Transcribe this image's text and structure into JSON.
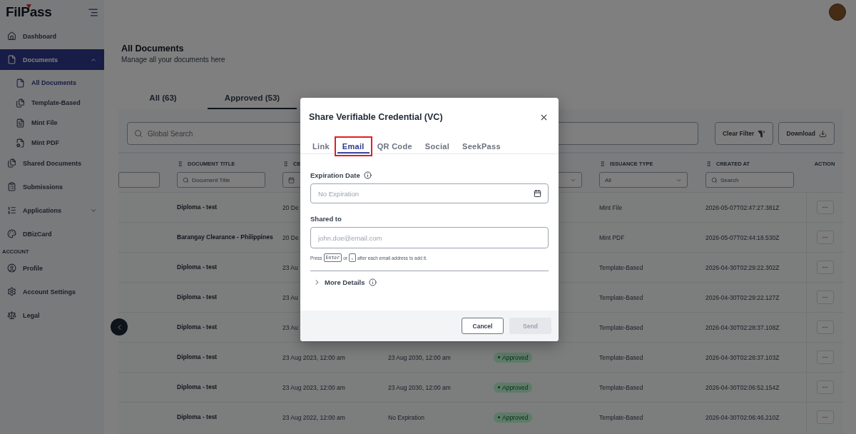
{
  "sidebar": {
    "logo": "FilPass",
    "groups": [
      {
        "items": [
          {
            "label": "Dashboard",
            "selected": false
          },
          {
            "label": "Documents",
            "selected": true,
            "expanded": true,
            "children": [
              {
                "label": "All Documents",
                "selected": true
              },
              {
                "label": "Template-Based",
                "selected": false
              },
              {
                "label": "Mint File",
                "selected": false
              },
              {
                "label": "Mint PDF",
                "selected": false
              }
            ]
          },
          {
            "label": "Shared Documents",
            "selected": false
          },
          {
            "label": "Submissions",
            "selected": false
          },
          {
            "label": "Applications",
            "selected": false,
            "expanded": false
          },
          {
            "label": "DBizCard",
            "selected": false
          }
        ]
      },
      {
        "label": "ACCOUNT",
        "items": [
          {
            "label": "Profile",
            "selected": false
          },
          {
            "label": "Account Settings",
            "selected": false
          },
          {
            "label": "Legal",
            "selected": false
          }
        ]
      }
    ]
  },
  "page": {
    "title": "All Documents",
    "subtitle": "Manage all your documents here"
  },
  "tabs": [
    {
      "label": "All (63)",
      "selected": false
    },
    {
      "label": "Approved (53)",
      "selected": true
    }
  ],
  "toolbar": {
    "search_placeholder": "Global Search",
    "buttons": [
      {
        "label": "Clear Filter",
        "kind": "clear"
      },
      {
        "label": "Download",
        "kind": "download"
      }
    ]
  },
  "table": {
    "columns": [
      {
        "kind": "data",
        "filter": {
          "kind": "text"
        }
      },
      {
        "kind": "data",
        "label": "DOCUMENT TITLE",
        "filter": {
          "kind": "search",
          "placeholder": "Document Title"
        }
      },
      {
        "kind": "data",
        "label": "CE",
        "filter": {
          "kind": "date"
        }
      },
      {
        "kind": "data"
      },
      {
        "kind": "data",
        "filter": {
          "kind": "select"
        }
      },
      {
        "kind": "data",
        "label": "ISSUANCE TYPE",
        "filter": {
          "kind": "select",
          "value": "All"
        }
      },
      {
        "kind": "data",
        "label": "CREATED AT",
        "filter": {
          "kind": "search",
          "placeholder": "Search"
        }
      },
      {
        "kind": "action",
        "label": "ACTION"
      }
    ],
    "rows": [
      {
        "title": "Diploma - test",
        "issued": "20 De",
        "issuance": "Mint File",
        "created": "2026-05-07T02:47:27.381Z"
      },
      {
        "title": "Barangay Clearance - Philippines",
        "issued": "20 De",
        "issuance": "Mint PDF",
        "created": "2026-05-07T02:44:18.530Z"
      },
      {
        "title": "Diploma - test",
        "issued": "23 Au",
        "issuance": "Template-Based",
        "created": "2026-04-30T02:29:22.302Z"
      },
      {
        "title": "Diploma - test",
        "issued": "23 Au",
        "issuance": "Template-Based",
        "created": "2026-04-30T02:29:22.127Z"
      },
      {
        "title": "Diploma - test",
        "issued": "23 Au",
        "issuance": "Template-Based",
        "created": "2026-04-30T02:28:37.108Z"
      },
      {
        "title": "Diploma - test",
        "issued": "23 Aug 2023, 12:00 am",
        "expiry": "23 Aug 2030, 12:00 am",
        "status": "Approved",
        "issuance": "Template-Based",
        "created": "2026-04-30T02:28:37.103Z"
      },
      {
        "title": "Diploma - test",
        "issued": "23 Aug 2023, 12:00 am",
        "expiry": "23 Aug 2030, 12:00 am",
        "status": "Approved",
        "issuance": "Template-Based",
        "created": "2026-04-30T02:06:52.154Z"
      },
      {
        "title": "Diploma - test",
        "issued": "23 Aug 2022, 12:00 am",
        "expiry": "No Expiration",
        "status": "Approved",
        "issuance": "Template-Based",
        "created": "2026-04-30T02:06:46.210Z"
      }
    ]
  },
  "modal": {
    "title": "Share Verifiable Credential (VC)",
    "tabs": [
      {
        "label": "Link",
        "selected": false,
        "highlighted": false
      },
      {
        "label": "Email",
        "selected": true,
        "highlighted": true
      },
      {
        "label": "QR Code",
        "selected": false,
        "highlighted": false
      },
      {
        "label": "Social",
        "selected": false,
        "highlighted": false
      },
      {
        "label": "SeekPass",
        "selected": false,
        "highlighted": false
      }
    ],
    "fields": [
      {
        "kind": "date",
        "label": "Expiration Date",
        "info": true,
        "placeholder": "No Expiration"
      },
      {
        "kind": "email",
        "label": "Shared to",
        "placeholder": "john.doe@email.com",
        "hint": {
          "before": "Press",
          "key_1": "Enter",
          "middle": "or",
          "key_2": ",",
          "after": "after each email address to add it."
        }
      }
    ],
    "more_details": {
      "label": "More Details",
      "expanded": false
    },
    "buttons": [
      {
        "label": "Cancel",
        "kind": "secondary",
        "disabled": false
      },
      {
        "label": "Send",
        "kind": "primary",
        "disabled": true
      }
    ]
  }
}
